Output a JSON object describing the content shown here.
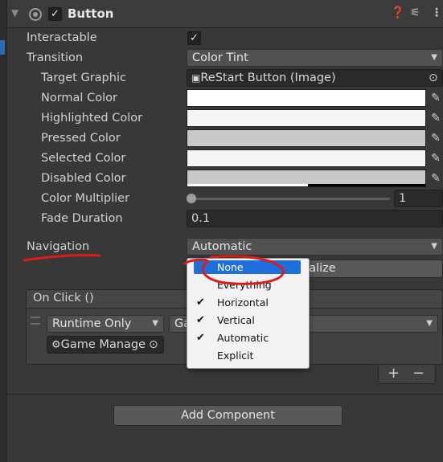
{
  "component": {
    "title": "Button",
    "enabled": true,
    "icons": [
      "help-icon",
      "preset-icon",
      "kebab-menu-icon"
    ]
  },
  "properties": {
    "interactable": {
      "label": "Interactable",
      "checked": true
    },
    "transition": {
      "label": "Transition",
      "value": "Color Tint"
    },
    "target_graphic": {
      "label": "Target Graphic",
      "value": "ReStart Button (Image)"
    },
    "normal_color": {
      "label": "Normal Color",
      "color": "#ffffff"
    },
    "highlighted_color": {
      "label": "Highlighted Color",
      "color": "#f5f5f5"
    },
    "pressed_color": {
      "label": "Pressed Color",
      "color": "#c8c8c8"
    },
    "selected_color": {
      "label": "Selected Color",
      "color": "#f5f5f5"
    },
    "disabled_color": {
      "label": "Disabled Color",
      "color": "#c8c8c8"
    },
    "color_multiplier": {
      "label": "Color Multiplier",
      "value": "1",
      "slider_fraction": 0.0
    },
    "fade_duration": {
      "label": "Fade Duration",
      "value": "0.1"
    },
    "navigation": {
      "label": "Navigation",
      "value": "Automatic"
    },
    "visualize_button": "ualize"
  },
  "on_click": {
    "header": "On Click ()",
    "runtime": "Runtime Only",
    "function_partial": "Ga",
    "object": "Game Manage"
  },
  "list_buttons": {
    "add": "+",
    "remove": "−"
  },
  "add_component": "Add Component",
  "navigation_menu": {
    "items": [
      {
        "label": "None",
        "checked": false,
        "selected": true
      },
      {
        "label": "Everything",
        "checked": false,
        "selected": false
      },
      {
        "label": "Horizontal",
        "checked": true,
        "selected": false
      },
      {
        "label": "Vertical",
        "checked": true,
        "selected": false
      },
      {
        "label": "Automatic",
        "checked": true,
        "selected": false
      },
      {
        "label": "Explicit",
        "checked": false,
        "selected": false
      }
    ]
  },
  "annotation_color": "#d91c1c"
}
